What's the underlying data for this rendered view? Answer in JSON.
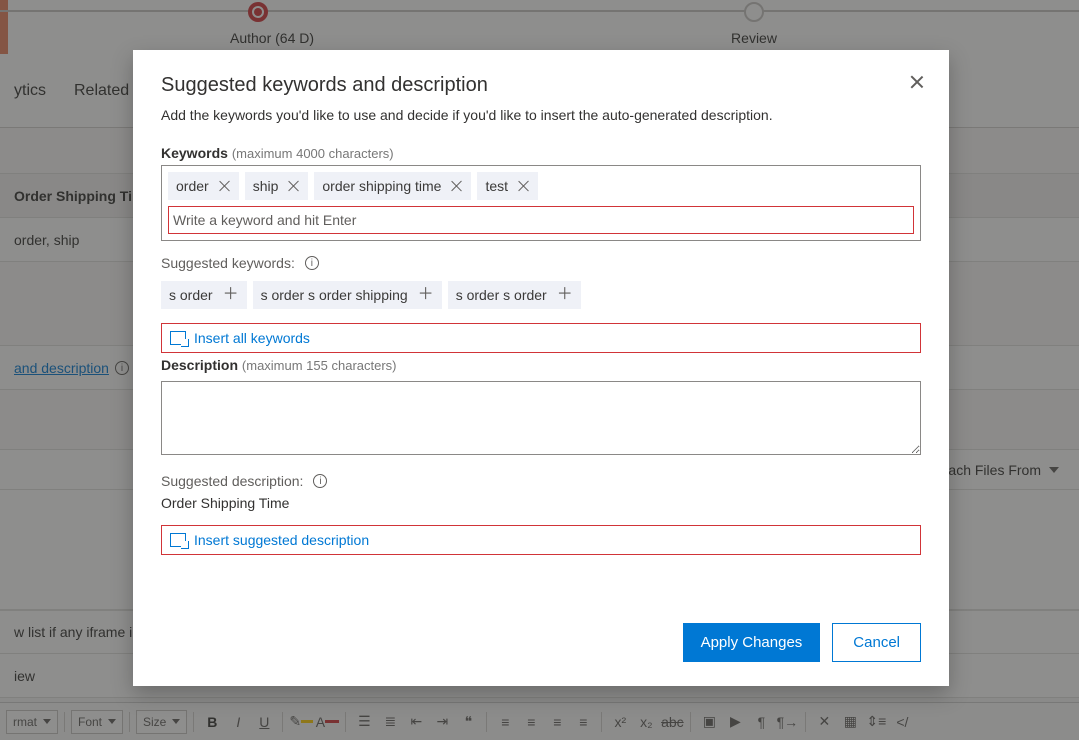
{
  "steps": {
    "author": {
      "label": "Author  (64 D)"
    },
    "review": {
      "label": "Review"
    }
  },
  "tabs": {
    "analytics": "ytics",
    "related": "Related"
  },
  "panel": {
    "orderShippingLabel": "Order Shipping Time",
    "keywordsValue": "order, ship",
    "suggLink": " and description",
    "iframeNote": "w list if any iframe in t",
    "viewTab": "iew",
    "attachFrom": "ach Files From"
  },
  "toolbar": {
    "format": "rmat",
    "font": "Font",
    "size": "Size",
    "bold": "B",
    "italic": "I",
    "underline": "U"
  },
  "modal": {
    "title": "Suggested keywords and description",
    "subtitle": "Add the keywords you'd like to use and decide if you'd like to insert the auto-generated description.",
    "keywordsLabel": "Keywords",
    "keywordsHint": "(maximum 4000 characters)",
    "chips": [
      "order",
      "ship",
      "order shipping time",
      "test"
    ],
    "kwPlaceholder": "Write a keyword and hit Enter",
    "suggKeywordsLabel": "Suggested keywords:",
    "suggChips": [
      "s order",
      "s order s order shipping",
      "s order s order"
    ],
    "insertAll": "Insert all keywords",
    "descriptionLabel": "Description",
    "descriptionHint": "(maximum 155 characters)",
    "suggDescLabel": "Suggested description:",
    "suggDescText": "Order Shipping Time",
    "insertDesc": "Insert suggested description",
    "apply": "Apply Changes",
    "cancel": "Cancel"
  }
}
